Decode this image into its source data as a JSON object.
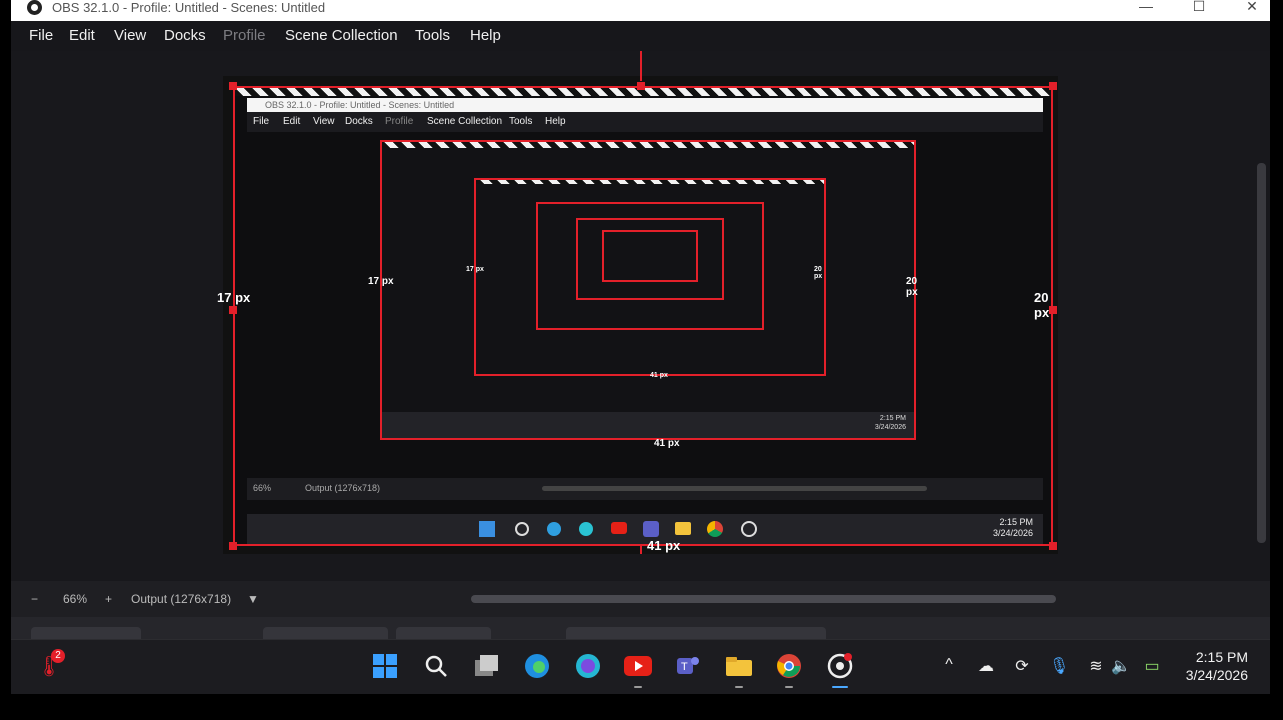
{
  "window": {
    "title": "OBS 32.1.0 - Profile: Untitled - Scenes: Untitled",
    "minimize_glyph": "—",
    "maximize_glyph": "☐",
    "close_glyph": "✕"
  },
  "menu": {
    "file": "File",
    "edit": "Edit",
    "view": "View",
    "docks": "Docks",
    "profile": "Profile",
    "scene_collection": "Scene Collection",
    "tools": "Tools",
    "help": "Help"
  },
  "preview": {
    "left_margin_label": "17 px",
    "right_margin_label": "20 px",
    "bottom_margin_label": "41 px",
    "inner_left_label": "17 px",
    "inner_right_label": "20 px",
    "inner_bottom_label": "41 px",
    "inner_time": "2:15 PM",
    "inner_date": "3/24/2026"
  },
  "controls": {
    "zoom_out": "−",
    "zoom_level": "66%",
    "zoom_in": "+",
    "output_label": "Output (1276x718)",
    "dropdown_glyph": "▼"
  },
  "taskbar": {
    "notification_count": "2",
    "time": "2:15 PM",
    "date": "3/24/2026",
    "apps": [
      "windows-start",
      "search",
      "task-view",
      "edge",
      "canva",
      "youtube",
      "teams",
      "file-explorer",
      "chrome",
      "obs"
    ]
  },
  "colors": {
    "selection_red": "#e3202a",
    "app_bg": "#1f1f23"
  }
}
